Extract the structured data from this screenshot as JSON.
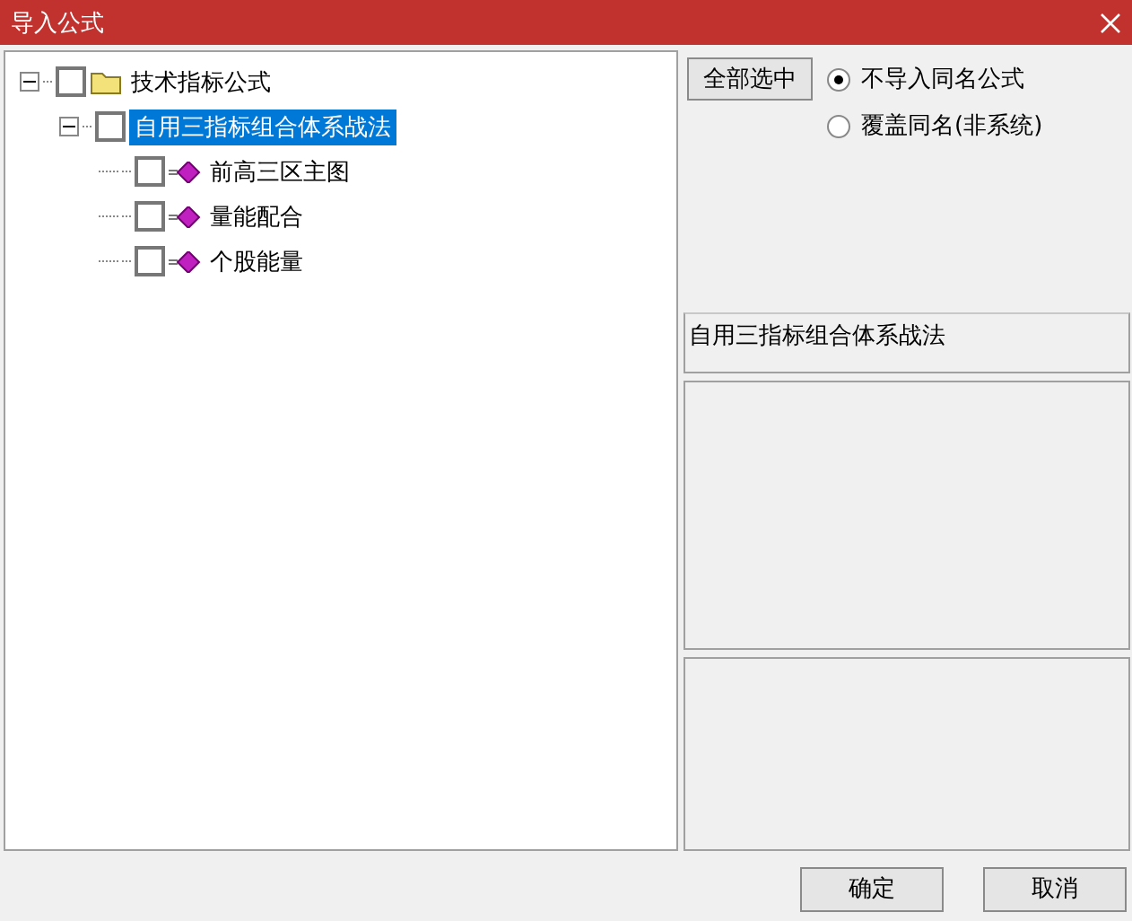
{
  "window": {
    "title": "导入公式"
  },
  "tree": [
    {
      "label": "技术指标公式",
      "kind": "folder",
      "expanded": true,
      "checked": false,
      "selected": false,
      "children": [
        {
          "label": "自用三指标组合体系战法",
          "expanded": true,
          "checked": false,
          "selected": true,
          "children": [
            {
              "label": "前高三区主图",
              "kind": "formula",
              "checked": false,
              "selected": false
            },
            {
              "label": "量能配合",
              "kind": "formula",
              "checked": false,
              "selected": false
            },
            {
              "label": "个股能量",
              "kind": "formula",
              "checked": false,
              "selected": false
            }
          ]
        }
      ]
    }
  ],
  "select_all_button": "全部选中",
  "options": [
    {
      "label": "不导入同名公式",
      "selected": true
    },
    {
      "label": "覆盖同名(非系统)",
      "selected": false
    }
  ],
  "description": "自用三指标组合体系战法",
  "buttons": [
    "确定",
    "取消"
  ]
}
